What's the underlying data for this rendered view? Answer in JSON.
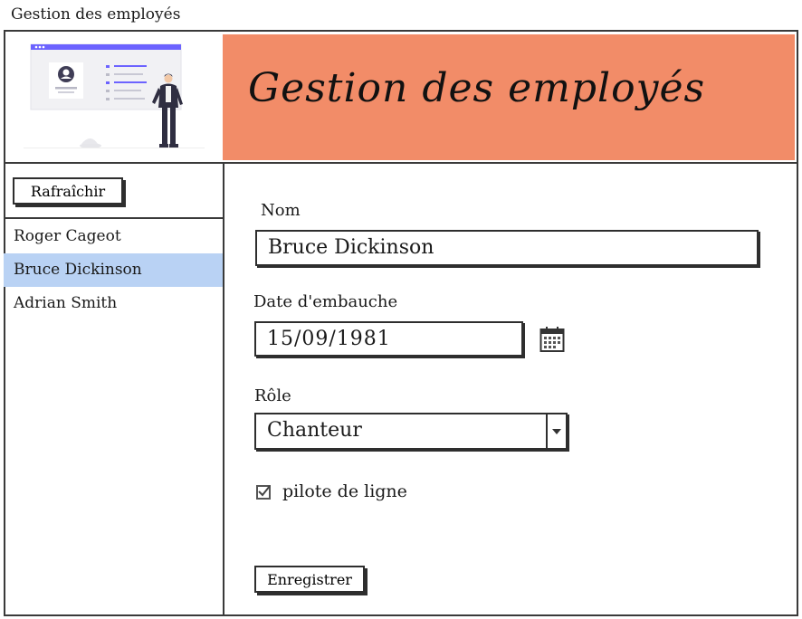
{
  "window": {
    "title": "Gestion des employés"
  },
  "header": {
    "title": "Gestion des employés"
  },
  "sidebar": {
    "refresh_label": "Rafraîchir",
    "employees": [
      {
        "name": "Roger Cageot"
      },
      {
        "name": "Bruce Dickinson"
      },
      {
        "name": "Adrian Smith"
      }
    ],
    "selected_index": 1
  },
  "form": {
    "nom_label": "Nom",
    "nom_value": "Bruce Dickinson",
    "date_label": "Date d'embauche",
    "date_value": "15/09/1981",
    "role_label": "Rôle",
    "role_value": "Chanteur",
    "pilot_label": "pilote de ligne",
    "pilot_checked": true,
    "save_label": "Enregistrer"
  },
  "colors": {
    "banner": "#f28c68",
    "selected_row": "#b9d2f4",
    "illustration_accent": "#6c63ff"
  },
  "icons": {
    "calendar": "calendar-icon",
    "dropdown": "chevron-down-icon",
    "checkbox": "check-icon"
  }
}
